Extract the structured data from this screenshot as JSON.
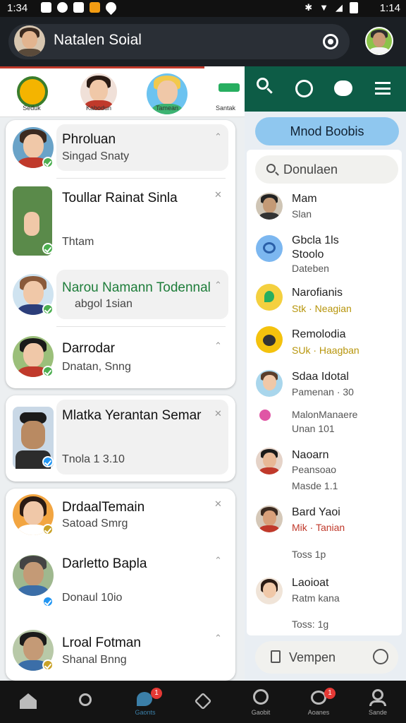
{
  "status_bar": {
    "time_left": "1:34",
    "time_right": "1:14"
  },
  "header": {
    "title": "Natalen Soial"
  },
  "stories": [
    {
      "label": "Seduk"
    },
    {
      "label": "Kabodun"
    },
    {
      "label": "Tamean"
    },
    {
      "label": "Santak"
    }
  ],
  "right_panel": {
    "pill_label": "Mnod Boobis",
    "search_placeholder": "Donulaen",
    "items": [
      {
        "line1": "Mam",
        "line2": "Slan"
      },
      {
        "line1": "Gbcla 1ls",
        "line2": "Stoolo",
        "line3": "Dateben"
      },
      {
        "line1": "Narofianis",
        "line2": "Stk · Neagian"
      },
      {
        "line1": "Remolodia",
        "line2": "SUk · Haagban"
      },
      {
        "line1": "Sdaa Idotal",
        "line2": "Pamenan · 30"
      },
      {
        "line1": "MalonManaere",
        "line2": "Unan 101"
      },
      {
        "line1": "Naoarn",
        "line2": "Peansoao",
        "line3": "Masde 1.1"
      },
      {
        "line1": "Bard Yaoi",
        "line2": "Mik · Tanian",
        "line3": "Toss 1p"
      },
      {
        "line1": "Laoioat",
        "line2": "Ratm kana",
        "line3": "Toss: 1g"
      }
    ],
    "compose_label": "Vempen"
  },
  "chats": [
    {
      "name": "Phroluan",
      "sub": "Singad Snaty"
    },
    {
      "name": "Toullar Rainat Sinla",
      "sub": "Thtam"
    },
    {
      "name": "Narou Namann Todennal",
      "sub": "abgol 1sian"
    },
    {
      "name": "Darrodar",
      "sub": "Dnatan, Snng"
    },
    {
      "name": "Mlatka Yerantan Semar",
      "sub": "Tnola 1 3.10"
    },
    {
      "name": "DrdaalTemain",
      "sub": "Satoad Smrg"
    },
    {
      "name": "Darletto Bapla",
      "sub": "Donaul 10io"
    },
    {
      "name": "Lroal Fotman",
      "sub": "Shanal Bnng"
    }
  ],
  "bottom_nav": [
    {
      "label": "",
      "icon": "home-icon"
    },
    {
      "label": "",
      "icon": "search-icon"
    },
    {
      "label": "Gaonts",
      "icon": "chat-icon",
      "badge": "1"
    },
    {
      "label": "",
      "icon": "house-icon"
    },
    {
      "label": "Gaobit",
      "icon": "clock-icon"
    },
    {
      "label": "Aoanes",
      "icon": "bell-icon",
      "badge": "1"
    },
    {
      "label": "Sande",
      "icon": "person-icon"
    }
  ],
  "colors": {
    "header_bg": "#1b1f24",
    "right_header": "#0d5c46",
    "badge_green": "#4caf50",
    "nav_badge": "#e53935"
  }
}
